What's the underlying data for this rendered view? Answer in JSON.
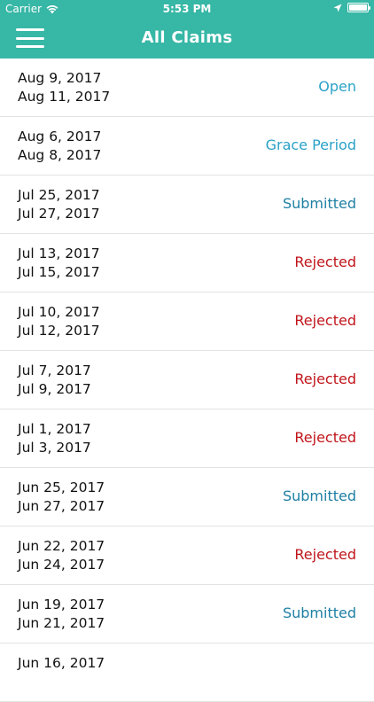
{
  "status_bar": {
    "carrier": "Carrier",
    "time": "5:53 PM"
  },
  "header": {
    "title": "All Claims"
  },
  "colors": {
    "brand": "#37b7a6",
    "open": "#2aa1c7",
    "submitted": "#1e7fa3",
    "rejected": "#c0141a"
  },
  "claims": [
    {
      "start": "Aug 9, 2017",
      "end": "Aug 11, 2017",
      "status": "Open"
    },
    {
      "start": "Aug 6, 2017",
      "end": "Aug 8, 2017",
      "status": "Grace Period"
    },
    {
      "start": "Jul 25, 2017",
      "end": "Jul 27, 2017",
      "status": "Submitted"
    },
    {
      "start": "Jul 13, 2017",
      "end": "Jul 15, 2017",
      "status": "Rejected"
    },
    {
      "start": "Jul 10, 2017",
      "end": "Jul 12, 2017",
      "status": "Rejected"
    },
    {
      "start": "Jul 7, 2017",
      "end": "Jul 9, 2017",
      "status": "Rejected"
    },
    {
      "start": "Jul 1, 2017",
      "end": "Jul 3, 2017",
      "status": "Rejected"
    },
    {
      "start": "Jun 25, 2017",
      "end": "Jun 27, 2017",
      "status": "Submitted"
    },
    {
      "start": "Jun 22, 2017",
      "end": "Jun 24, 2017",
      "status": "Rejected"
    },
    {
      "start": "Jun 19, 2017",
      "end": "Jun 21, 2017",
      "status": "Submitted"
    },
    {
      "start": "Jun 16, 2017",
      "end": "",
      "status": ""
    }
  ]
}
